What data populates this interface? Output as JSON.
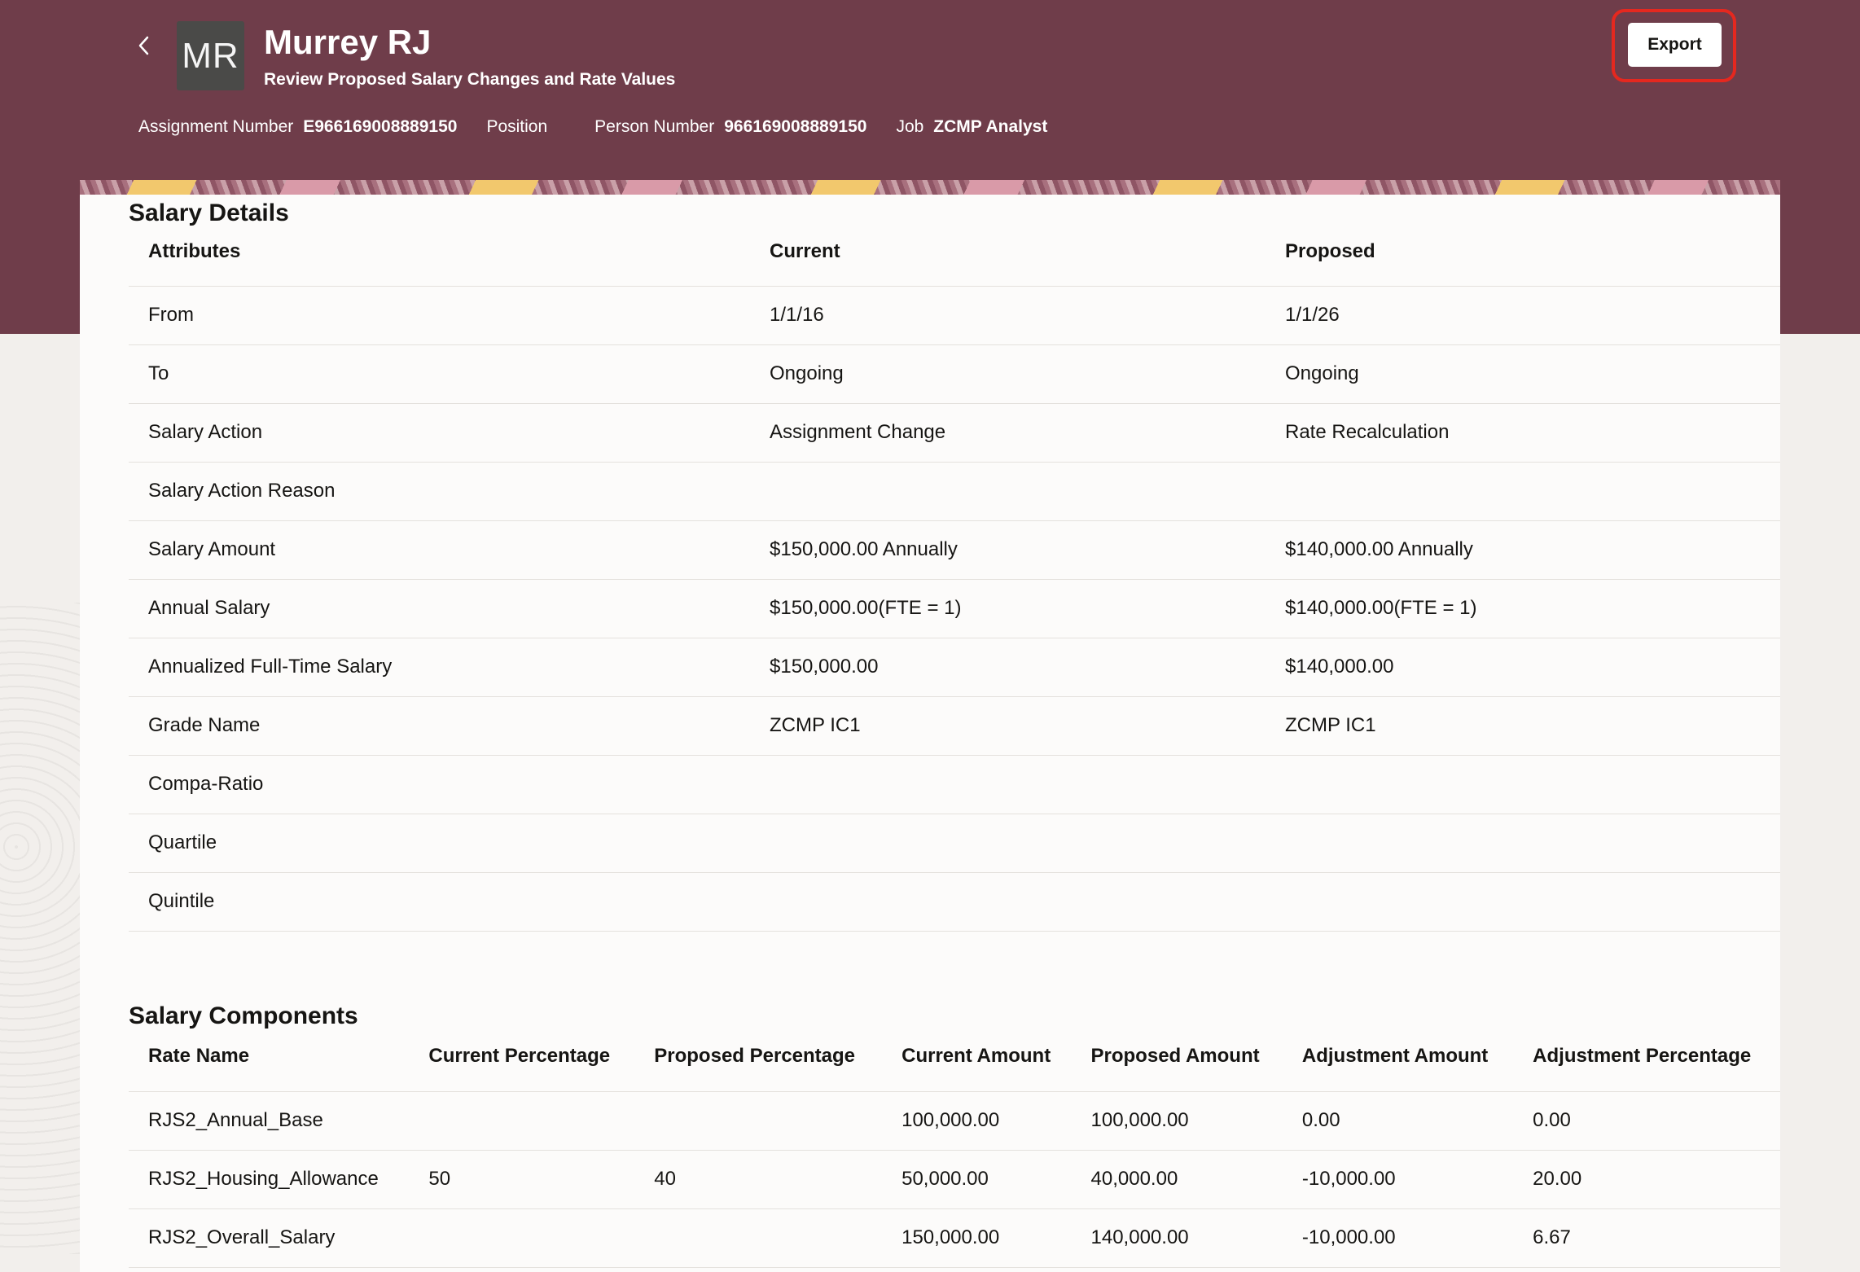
{
  "header": {
    "initials": "MR",
    "name": "Murrey RJ",
    "subtitle": "Review Proposed Salary Changes and Rate Values",
    "export_label": "Export",
    "meta": [
      {
        "label": "Assignment Number",
        "value": "E966169008889150"
      },
      {
        "label": "Position",
        "value": ""
      },
      {
        "label": "Person Number",
        "value": "966169008889150"
      },
      {
        "label": "Job",
        "value": "ZCMP Analyst"
      }
    ]
  },
  "salary_details": {
    "title": "Salary Details",
    "columns": [
      "Attributes",
      "Current",
      "Proposed"
    ],
    "rows": [
      [
        "From",
        "1/1/16",
        "1/1/26"
      ],
      [
        "To",
        "Ongoing",
        "Ongoing"
      ],
      [
        "Salary Action",
        "Assignment Change",
        "Rate Recalculation"
      ],
      [
        "Salary Action Reason",
        "",
        ""
      ],
      [
        "Salary Amount",
        "$150,000.00 Annually",
        "$140,000.00 Annually"
      ],
      [
        "Annual Salary",
        "$150,000.00(FTE = 1)",
        "$140,000.00(FTE = 1)"
      ],
      [
        "Annualized Full-Time Salary",
        "$150,000.00",
        "$140,000.00"
      ],
      [
        "Grade Name",
        "ZCMP IC1",
        "ZCMP IC1"
      ],
      [
        "Compa-Ratio",
        "",
        ""
      ],
      [
        "Quartile",
        "",
        ""
      ],
      [
        "Quintile",
        "",
        ""
      ]
    ]
  },
  "salary_components": {
    "title": "Salary Components",
    "columns": [
      "Rate Name",
      "Current Percentage",
      "Proposed Percentage",
      "Current Amount",
      "Proposed Amount",
      "Adjustment Amount",
      "Adjustment Percentage"
    ],
    "rows": [
      [
        "RJS2_Annual_Base",
        "",
        "",
        "100,000.00",
        "100,000.00",
        "0.00",
        "0.00"
      ],
      [
        "RJS2_Housing_Allowance",
        "50",
        "40",
        "50,000.00",
        "40,000.00",
        "-10,000.00",
        "20.00"
      ],
      [
        "RJS2_Overall_Salary",
        "",
        "",
        "150,000.00",
        "140,000.00",
        "-10,000.00",
        "6.67"
      ]
    ]
  }
}
